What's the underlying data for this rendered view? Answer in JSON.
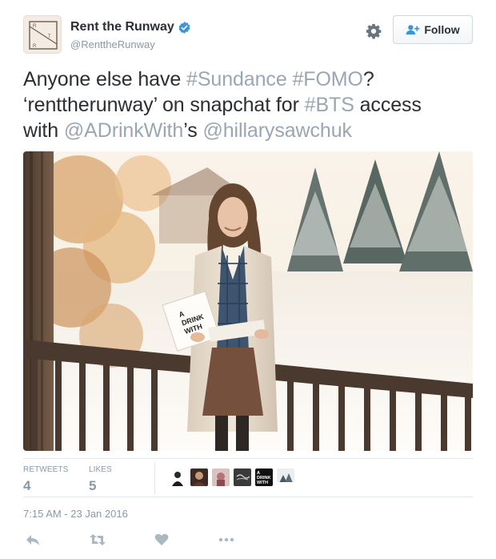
{
  "tweet": {
    "user": {
      "name": "Rent the Runway",
      "handle": "@RenttheRunway",
      "avatar_letters": [
        "R",
        "T",
        "R"
      ],
      "verified": true,
      "verified_color": "#3b94d9"
    },
    "follow_label": "Follow",
    "text": {
      "line1": [
        {
          "text": "Anyone else have ",
          "link": false
        },
        {
          "text": "#Sundance",
          "link": true
        },
        {
          "text": " ",
          "link": false
        },
        {
          "text": "#FOMO",
          "link": true
        },
        {
          "text": "?",
          "link": false
        }
      ],
      "line2": [
        {
          "text": "‘renttherunway’ on snapchat for ",
          "link": false
        },
        {
          "text": "#BTS",
          "link": true
        },
        {
          "text": " access",
          "link": false
        }
      ],
      "line3": [
        {
          "text": "with ",
          "link": false
        },
        {
          "text": "@ADrinkWith",
          "link": true
        },
        {
          "text": "’s ",
          "link": false
        },
        {
          "text": "@hillarysawchuk",
          "link": true
        }
      ]
    },
    "photo": {
      "card_text": [
        "A",
        "DRINK",
        "WITH"
      ]
    },
    "stats": {
      "retweets_label": "RETWEETS",
      "retweets_count": "4",
      "likes_label": "LIKES",
      "likes_count": "5"
    },
    "liker_card_text": [
      "A",
      "DRINK",
      "WITH"
    ],
    "timestamp": "7:15 AM - 23 Jan 2016",
    "actions": [
      "reply-icon",
      "retweet-icon",
      "like-icon",
      "more-icon"
    ],
    "colors": {
      "link": "#9aa7b2",
      "muted": "#8899a6",
      "text": "#292f33"
    }
  }
}
